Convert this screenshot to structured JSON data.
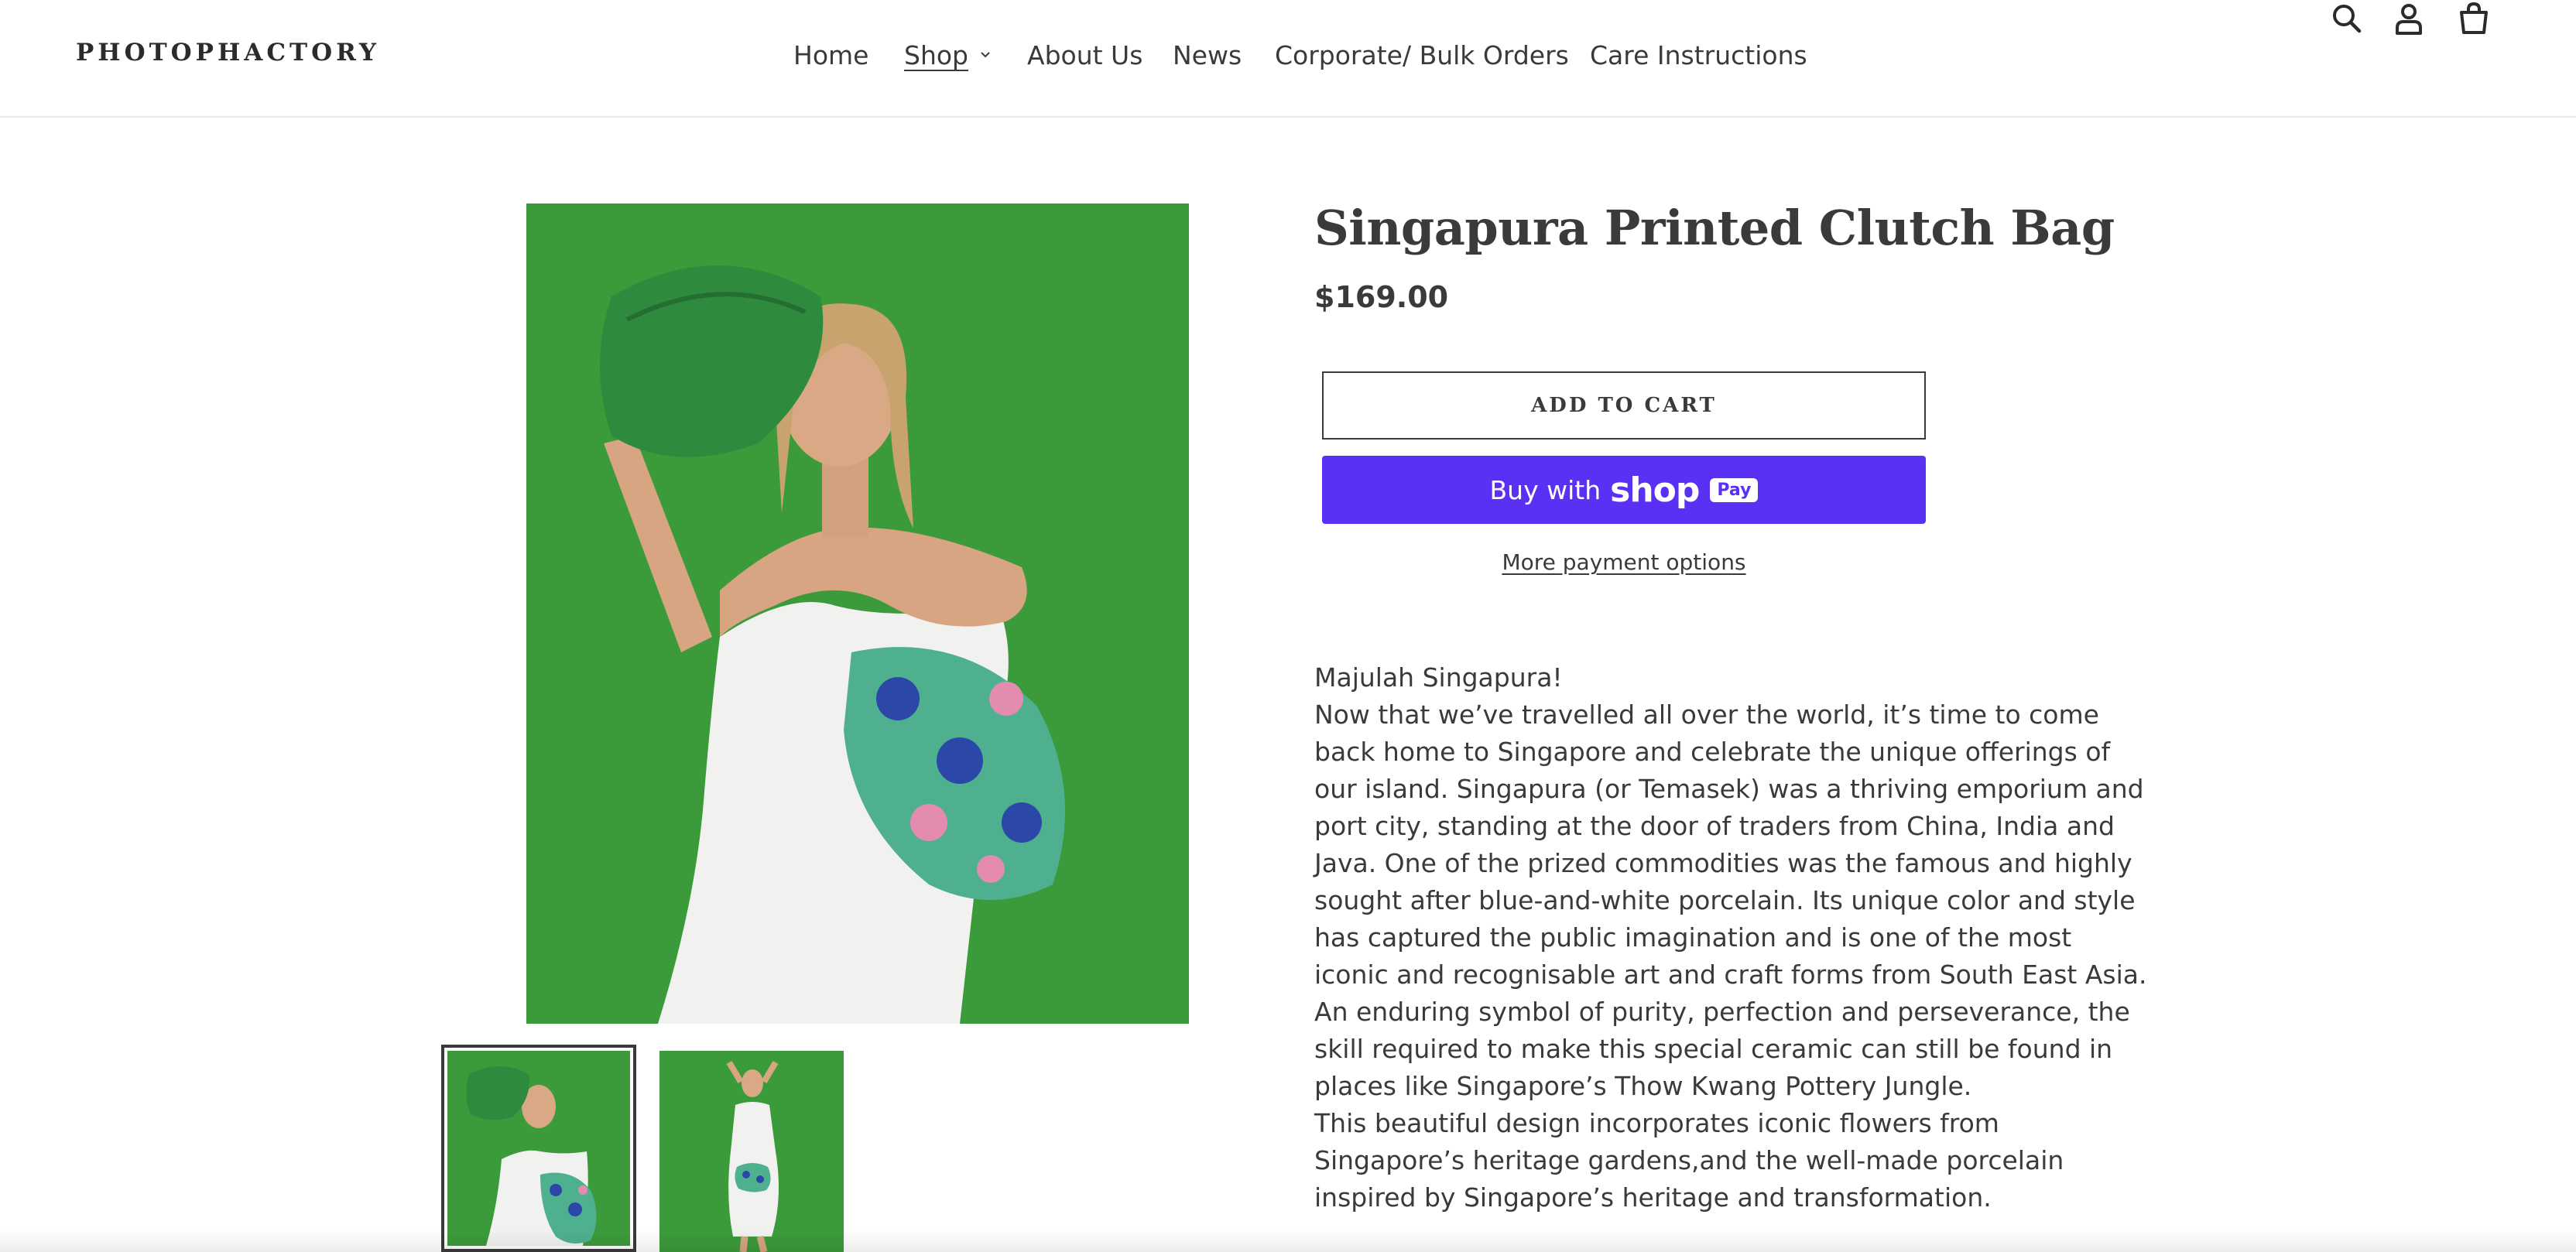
{
  "header": {
    "logo": "PHOTOPHACTORY",
    "nav": {
      "home": "Home",
      "shop": "Shop",
      "about": "About Us",
      "news": "News",
      "corporate": "Corporate/ Bulk Orders",
      "care": "Care Instructions"
    },
    "icons": [
      "search-icon",
      "account-icon",
      "cart-icon"
    ]
  },
  "product": {
    "title": "Singapura Printed Clutch Bag",
    "price": "$169.00",
    "add_to_cart": "ADD TO CART",
    "buy_with": "Buy with",
    "shop_word": "shop",
    "pay_badge": "Pay",
    "more_payment": "More payment options",
    "description": [
      "Majulah Singapura!",
      "Now that we’ve travelled all over the world, it’s time to come back home to Singapore and celebrate the unique offerings of our island. Singapura (or Temasek) was a thriving emporium and port city, standing at the door of traders from China, India and Java. One of the prized commodities was the famous and highly sought after blue-and-white porcelain. Its unique color and style has captured the public imagination and is one of the most iconic and recognisable art and craft forms from South East Asia. An enduring symbol of purity, perfection and perseverance, the skill required to make this special ceramic can still be found in places like Singapore’s Thow Kwang Pottery Jungle.",
      "This beautiful design incorporates iconic flowers from Singapore’s heritage gardens,and the well-made porcelain inspired by Singapore’s heritage and transformation."
    ]
  },
  "colors": {
    "accent_shop_pay": "#5a31f4",
    "photo_background": "#3b9b3a",
    "text": "#3a3a3a"
  }
}
